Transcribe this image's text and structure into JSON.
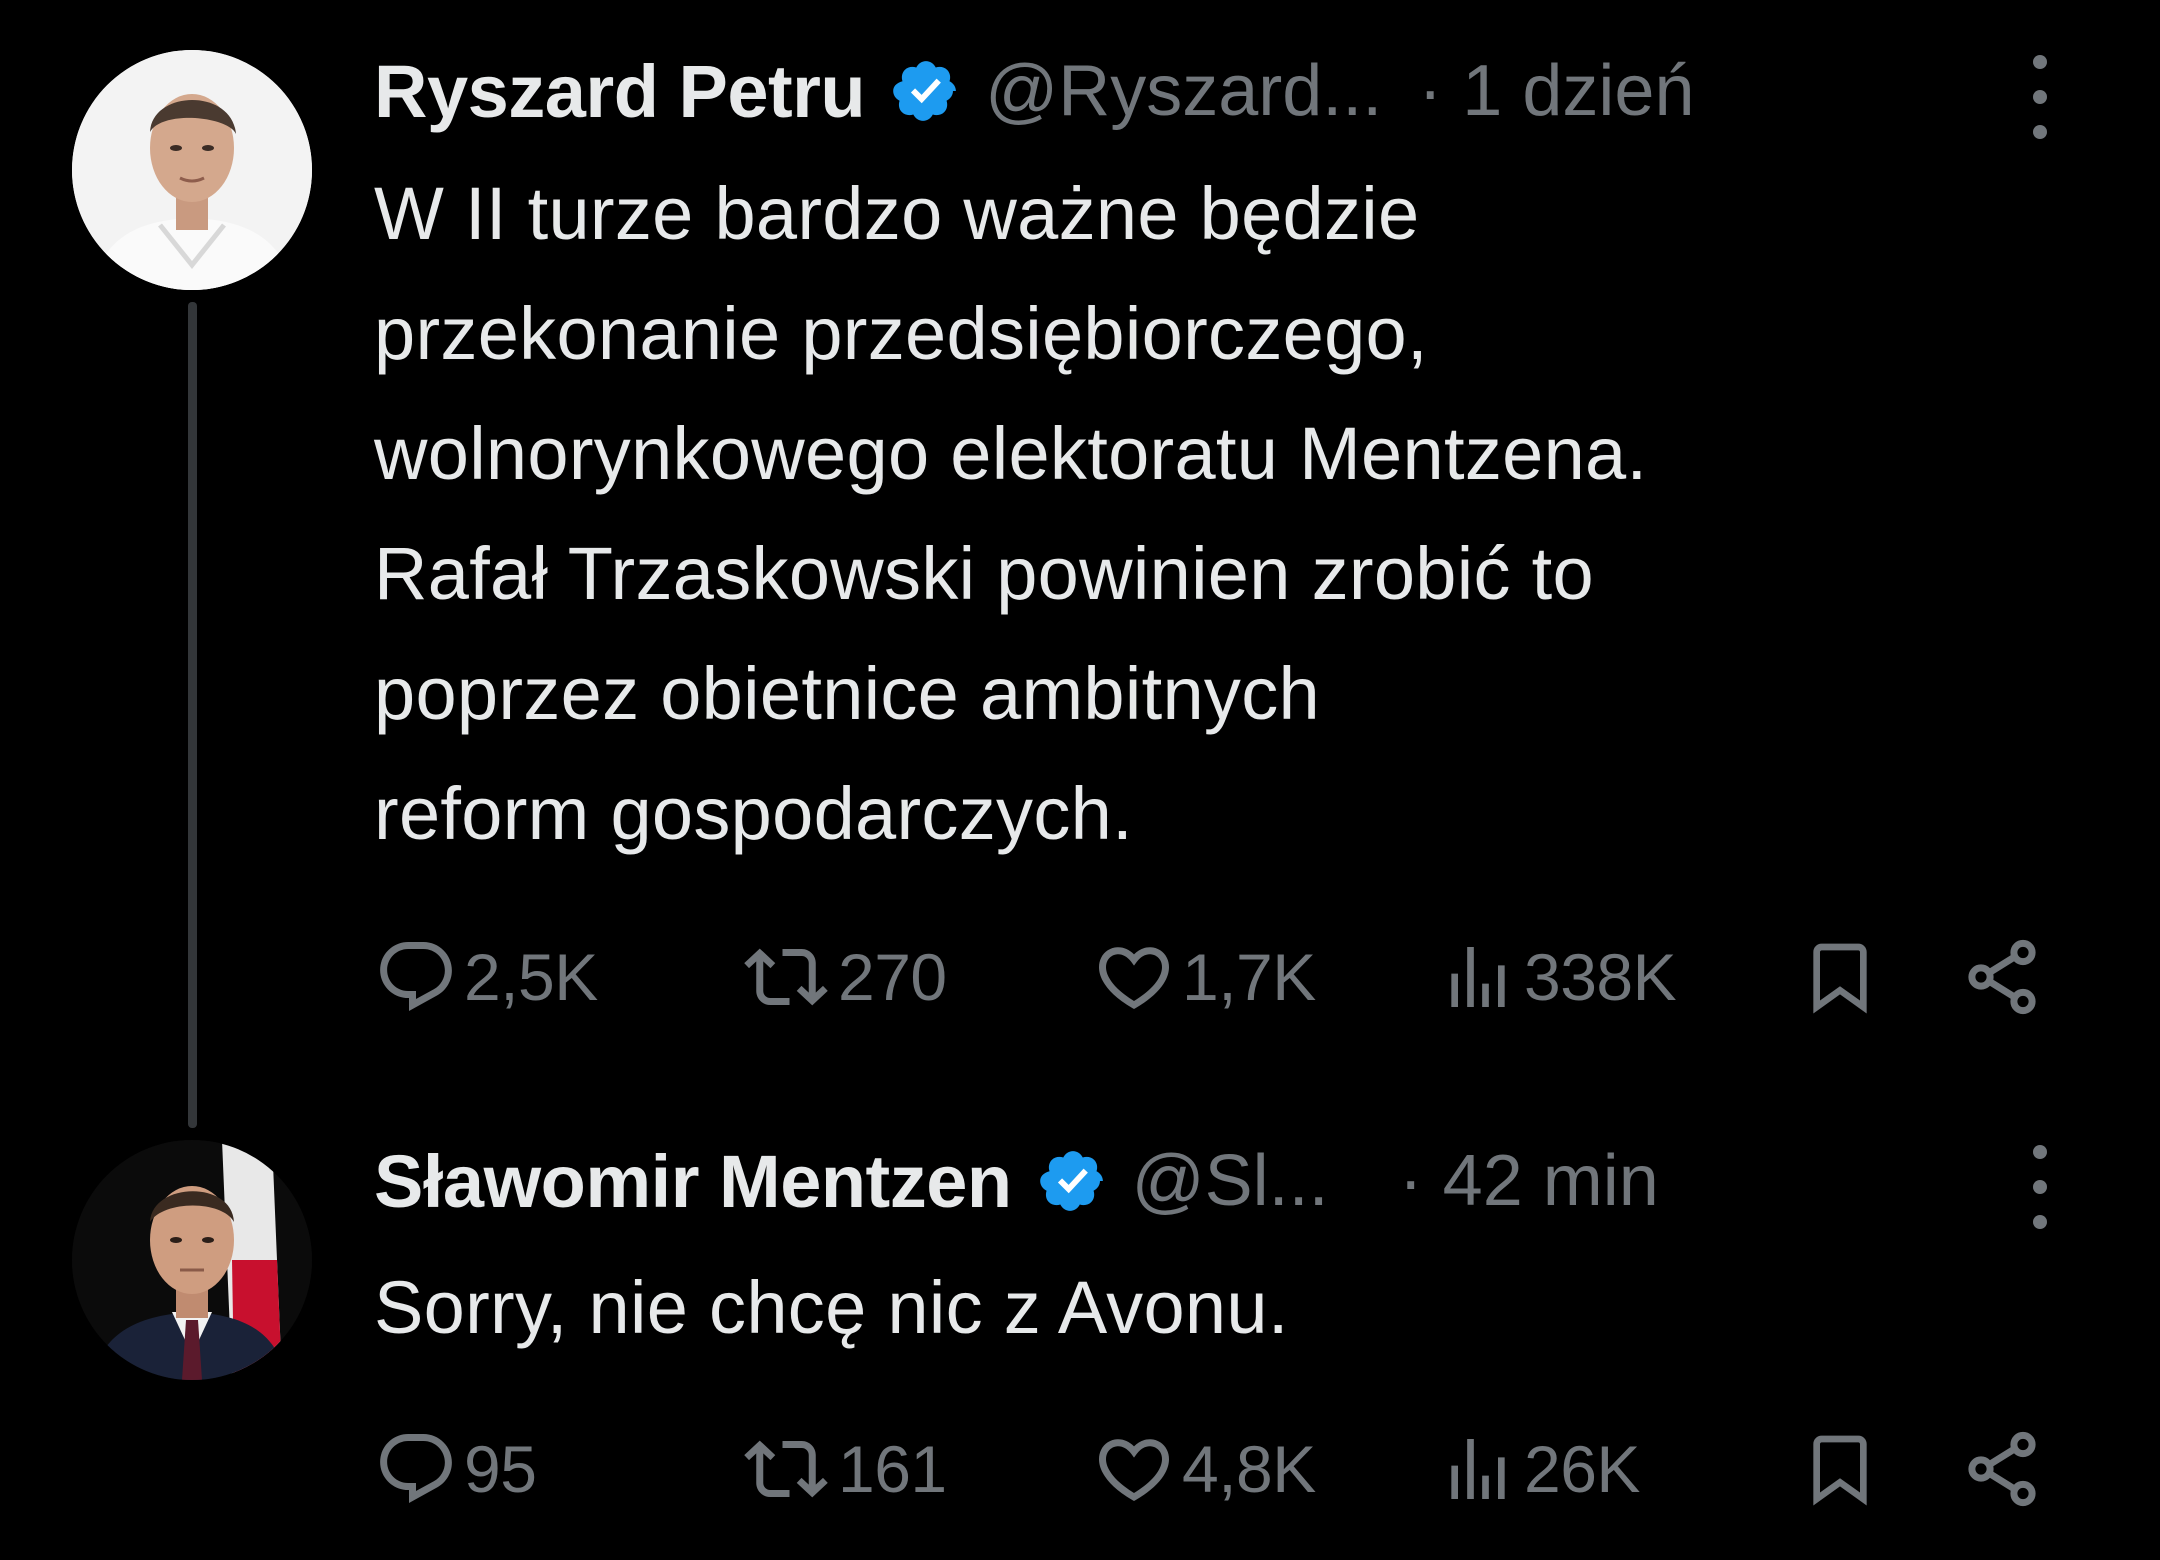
{
  "tweets": [
    {
      "display_name": "Ryszard Petru",
      "handle": "@Ryszard...",
      "time": "· 1 dzień",
      "text": "W II turze bardzo ważne będzie\nprzekonanie przedsiębiorczego,\nwolnorynkowego elektoratu Mentzena.\nRafał Trzaskowski powinien zrobić to\npoprzez obietnice ambitnych\nreform gospodarczych.",
      "replies": "2,5K",
      "retweets": "270",
      "likes": "1,7K",
      "views": "338K",
      "verified": true,
      "avatar_icon": "person-photo-avatar"
    },
    {
      "display_name": "Sławomir Mentzen",
      "handle": "@Sl...",
      "time": "· 42 min",
      "text": "Sorry, nie chcę nic z Avonu.",
      "replies": "95",
      "retweets": "161",
      "likes": "4,8K",
      "views": "26K",
      "verified": true,
      "avatar_icon": "person-photo-avatar"
    }
  ],
  "icons": {
    "reply": "speech-bubble-icon",
    "retweet": "retweet-arrows-icon",
    "like": "heart-icon",
    "views": "bar-chart-icon",
    "bookmark": "bookmark-icon",
    "share": "share-icon",
    "more": "vertical-ellipsis-icon",
    "verified": "verified-badge-icon"
  },
  "colors": {
    "background": "#000000",
    "text_primary": "#e7e9ea",
    "text_secondary": "#71767b",
    "verified_blue": "#1d9bf0",
    "thread_line": "#333639"
  }
}
